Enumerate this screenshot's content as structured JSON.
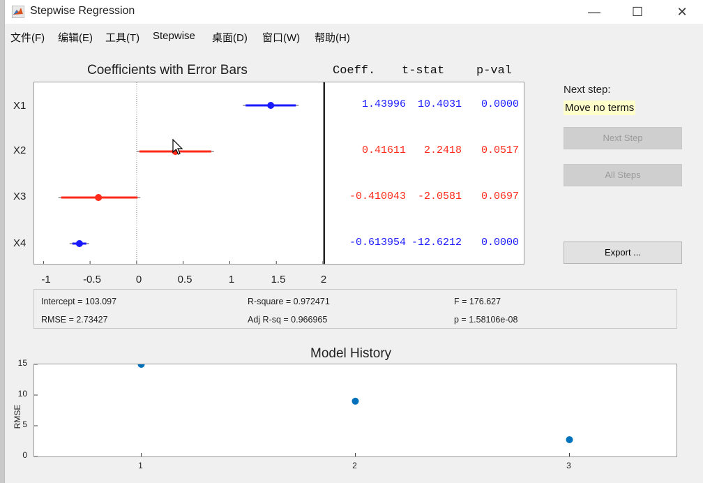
{
  "window": {
    "title": "Stepwise Regression",
    "controls": {
      "minimize": "—",
      "maximize": "☐",
      "close": "✕"
    }
  },
  "menu": [
    "文件(F)",
    "编辑(E)",
    "工具(T)",
    "Stepwise",
    "桌面(D)",
    "窗口(W)",
    "帮助(H)"
  ],
  "coef_panel": {
    "title": "Coefficients with Error Bars",
    "headers": {
      "coeff": "Coeff.",
      "tstat": "t-stat",
      "pval": "p-val"
    },
    "rows": [
      {
        "label": "X1",
        "coeff": "1.43996",
        "tstat": "10.4031",
        "pval": "0.0000",
        "color": "#1a1aff"
      },
      {
        "label": "X2",
        "coeff": "0.41611",
        "tstat": "2.2418",
        "pval": "0.0517",
        "color": "#ff2a1a"
      },
      {
        "label": "X3",
        "coeff": "-0.410043",
        "tstat": "-2.0581",
        "pval": "0.0697",
        "color": "#ff2a1a"
      },
      {
        "label": "X4",
        "coeff": "-0.613954",
        "tstat": "-12.6212",
        "pval": "0.0000",
        "color": "#1a1aff"
      }
    ],
    "x_ticks": [
      "-1",
      "-0.5",
      "0",
      "0.5",
      "1",
      "1.5",
      "2"
    ]
  },
  "chart_data": [
    {
      "type": "scatter",
      "title": "Coefficients with Error Bars",
      "xlim": [
        -1.1,
        2.0
      ],
      "categories": [
        "X1",
        "X2",
        "X3",
        "X4"
      ],
      "points": [
        {
          "label": "X1",
          "value": 1.43996,
          "ci": [
            1.14,
            1.74
          ],
          "color": "#1a1aff"
        },
        {
          "label": "X2",
          "value": 0.41611,
          "ci": [
            0.0,
            0.83
          ],
          "color": "#ff2a1a"
        },
        {
          "label": "X3",
          "value": -0.410043,
          "ci": [
            -0.84,
            0.04
          ],
          "color": "#ff2a1a"
        },
        {
          "label": "X4",
          "value": -0.613954,
          "ci": [
            -0.72,
            -0.51
          ],
          "color": "#1a1aff"
        }
      ],
      "zero_line": true
    },
    {
      "type": "scatter",
      "title": "Model History",
      "ylabel": "RMSE",
      "x": [
        1,
        2,
        3
      ],
      "y": [
        15.0,
        9.0,
        2.73427
      ],
      "xlim": [
        0.5,
        3.5
      ],
      "ylim": [
        0,
        15
      ],
      "x_ticks": [
        "1",
        "2",
        "3"
      ],
      "y_ticks": [
        "0",
        "5",
        "10",
        "15"
      ],
      "color": "#0072bd"
    }
  ],
  "next_step": {
    "label": "Next step:",
    "value": "Move no terms"
  },
  "buttons": {
    "next_step": "Next Step",
    "all_steps": "All Steps",
    "export": "Export ..."
  },
  "stats": {
    "intercept": "Intercept = 103.097",
    "rmse": "RMSE = 2.73427",
    "rsquare": "R-square = 0.972471",
    "adjrsq": "Adj R-sq = 0.966965",
    "f": "F = 176.627",
    "p": "p = 1.58106e-08"
  },
  "history": {
    "title": "Model History",
    "ylabel": "RMSE"
  }
}
